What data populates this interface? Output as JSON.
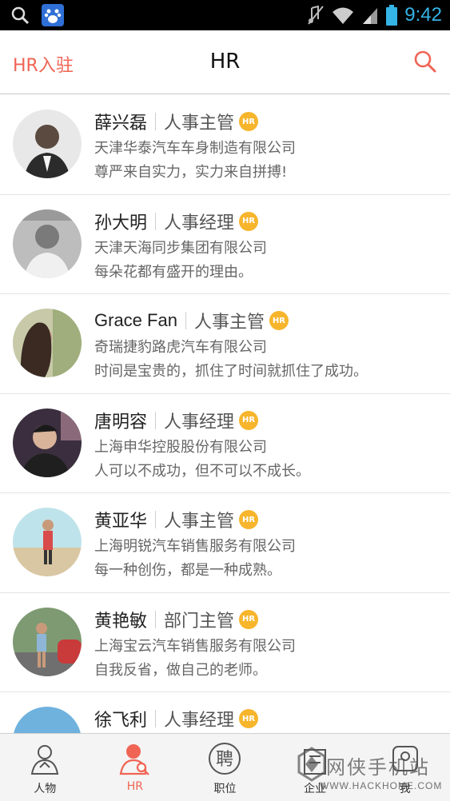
{
  "statusbar": {
    "time": "9:42"
  },
  "header": {
    "left_link": "HR入驻",
    "title": "HR"
  },
  "list": [
    {
      "name": "薛兴磊",
      "role": "人事主管",
      "badge": "HR",
      "company": "天津华泰汽车车身制造有限公司",
      "motto": "尊严来自实力，实力来自拼搏!"
    },
    {
      "name": "孙大明",
      "role": "人事经理",
      "badge": "HR",
      "company": "天津天海同步集团有限公司",
      "motto": "每朵花都有盛开的理由。"
    },
    {
      "name": "Grace Fan",
      "role": "人事主管",
      "badge": "HR",
      "company": "奇瑞捷豹路虎汽车有限公司",
      "motto": "时间是宝贵的，抓住了时间就抓住了成功。"
    },
    {
      "name": "唐明容",
      "role": "人事经理",
      "badge": "HR",
      "company": "上海申华控股股份有限公司",
      "motto": "人可以不成功，但不可以不成长。"
    },
    {
      "name": "黄亚华",
      "role": "人事主管",
      "badge": "HR",
      "company": "上海明锐汽车销售服务有限公司",
      "motto": "每一种创伤，都是一种成熟。"
    },
    {
      "name": "黄艳敏",
      "role": "部门主管",
      "badge": "HR",
      "company": "上海宝云汽车销售服务有限公司",
      "motto": "自我反省，做自己的老师。"
    },
    {
      "name": "徐飞利",
      "role": "人事经理",
      "badge": "HR",
      "company": "",
      "motto": ""
    }
  ],
  "bottomnav": [
    {
      "label": "人物",
      "icon": "person-icon"
    },
    {
      "label": "HR",
      "icon": "hr-icon"
    },
    {
      "label": "职位",
      "icon": "job-icon"
    },
    {
      "label": "企业",
      "icon": "company-icon"
    },
    {
      "label": "我",
      "icon": "me-icon"
    }
  ],
  "watermark": {
    "text": "网侠手机站",
    "url": "WWW.HACKHOME.COM"
  },
  "colors": {
    "accent": "#f06454",
    "badge": "#f7b52c",
    "status_time": "#35b4e6"
  }
}
